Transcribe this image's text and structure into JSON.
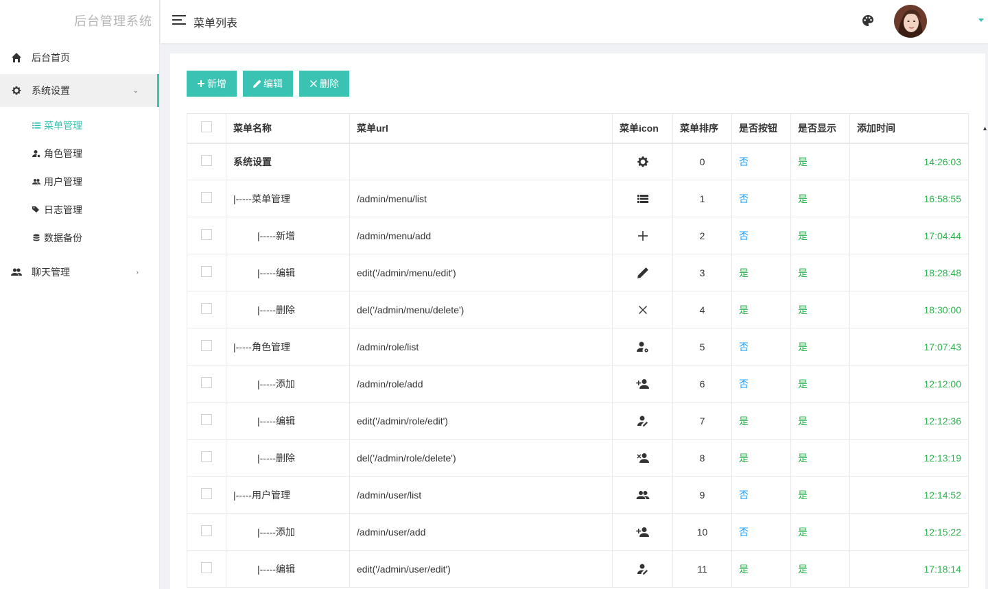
{
  "brand": "后台管理系统",
  "header": {
    "title": "菜单列表"
  },
  "sidebar": {
    "items": [
      {
        "label": "后台首页",
        "icon": "home-icon"
      },
      {
        "label": "系统设置",
        "icon": "gear-icon",
        "expanded": true
      },
      {
        "label": "聊天管理",
        "icon": "users-icon"
      }
    ],
    "sub_items": [
      {
        "label": "菜单管理",
        "icon": "list-icon",
        "active": true
      },
      {
        "label": "角色管理",
        "icon": "user-gear-icon"
      },
      {
        "label": "用户管理",
        "icon": "users-icon"
      },
      {
        "label": "日志管理",
        "icon": "tags-icon"
      },
      {
        "label": "数据备份",
        "icon": "database-icon"
      }
    ]
  },
  "toolbar": {
    "add_label": "新增",
    "edit_label": "编辑",
    "delete_label": "删除"
  },
  "table": {
    "headers": [
      "菜单名称",
      "菜单url",
      "菜单icon",
      "菜单排序",
      "是否按钮",
      "是否显示",
      "添加时间"
    ],
    "rows": [
      {
        "name": "系统设置",
        "url": "",
        "icon": "gear-icon",
        "order": "0",
        "is_button": "否",
        "is_shown": "是",
        "time": "14:26:03"
      },
      {
        "name": "|-----菜单管理",
        "url": "/admin/menu/list",
        "icon": "list-icon",
        "order": "1",
        "is_button": "否",
        "is_shown": "是",
        "time": "16:58:55"
      },
      {
        "name": "|-----新增",
        "url": "/admin/menu/add",
        "icon": "plus-icon",
        "order": "2",
        "is_button": "否",
        "is_shown": "是",
        "time": "17:04:44"
      },
      {
        "name": "|-----编辑",
        "url": "edit('/admin/menu/edit')",
        "icon": "pencil-icon",
        "order": "3",
        "is_button": "是",
        "is_shown": "是",
        "time": "18:28:48"
      },
      {
        "name": "|-----删除",
        "url": "del('/admin/menu/delete')",
        "icon": "close-icon",
        "order": "4",
        "is_button": "是",
        "is_shown": "是",
        "time": "18:30:00"
      },
      {
        "name": "|-----角色管理",
        "url": "/admin/role/list",
        "icon": "user-gear-icon",
        "order": "5",
        "is_button": "否",
        "is_shown": "是",
        "time": "17:07:43"
      },
      {
        "name": "|-----添加",
        "url": "/admin/role/add",
        "icon": "user-plus-icon",
        "order": "6",
        "is_button": "否",
        "is_shown": "是",
        "time": "12:12:00"
      },
      {
        "name": "|-----编辑",
        "url": "edit('/admin/role/edit')",
        "icon": "user-edit-icon",
        "order": "7",
        "is_button": "是",
        "is_shown": "是",
        "time": "12:12:36"
      },
      {
        "name": "|-----删除",
        "url": "del('/admin/role/delete')",
        "icon": "user-remove-icon",
        "order": "8",
        "is_button": "是",
        "is_shown": "是",
        "time": "12:13:19"
      },
      {
        "name": "|-----用户管理",
        "url": "/admin/user/list",
        "icon": "users-icon",
        "order": "9",
        "is_button": "否",
        "is_shown": "是",
        "time": "12:14:52"
      },
      {
        "name": "|-----添加",
        "url": "/admin/user/add",
        "icon": "user-plus-icon",
        "order": "10",
        "is_button": "否",
        "is_shown": "是",
        "time": "12:15:22"
      },
      {
        "name": "|-----编辑",
        "url": "edit('/admin/user/edit')",
        "icon": "user-edit-icon",
        "order": "11",
        "is_button": "是",
        "is_shown": "是",
        "time": "17:18:14"
      }
    ]
  },
  "colors": {
    "accent": "#3ac2b2",
    "no": "#1e9fff",
    "yes": "#29b44c"
  }
}
